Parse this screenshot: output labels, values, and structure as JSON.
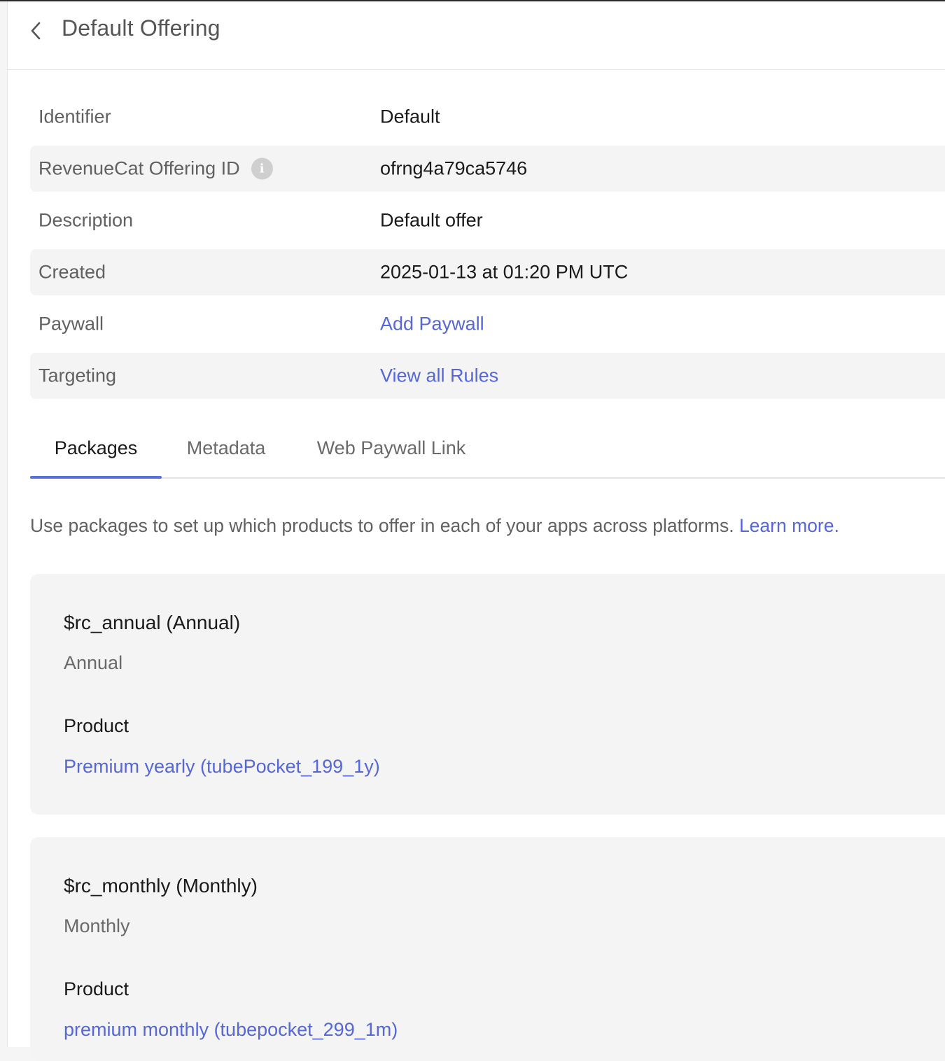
{
  "header": {
    "title": "Default Offering"
  },
  "details": {
    "rows": [
      {
        "label": "Identifier",
        "value": "Default"
      },
      {
        "label": "RevenueCat Offering ID",
        "value": "ofrng4a79ca5746"
      },
      {
        "label": "Description",
        "value": "Default offer"
      },
      {
        "label": "Created",
        "value": "2025-01-13 at 01:20 PM UTC"
      },
      {
        "label": "Paywall",
        "value": "Add Paywall"
      },
      {
        "label": "Targeting",
        "value": "View all Rules"
      }
    ]
  },
  "tabs": [
    {
      "label": "Packages",
      "active": true
    },
    {
      "label": "Metadata",
      "active": false
    },
    {
      "label": "Web Paywall Link",
      "active": false
    }
  ],
  "intro": {
    "text": "Use packages to set up which products to offer in each of your apps across platforms. ",
    "link": "Learn more."
  },
  "packages": [
    {
      "title": "$rc_annual (Annual)",
      "subtitle": "Annual",
      "product_label": "Product",
      "product": "Premium yearly (tubePocket_199_1y)"
    },
    {
      "title": "$rc_monthly (Monthly)",
      "subtitle": "Monthly",
      "product_label": "Product",
      "product": "premium monthly (tubepocket_299_1m)"
    }
  ],
  "colors": {
    "accent": "#5a6fd8",
    "link": "#5567d9",
    "row_shade": "#f4f4f4"
  }
}
